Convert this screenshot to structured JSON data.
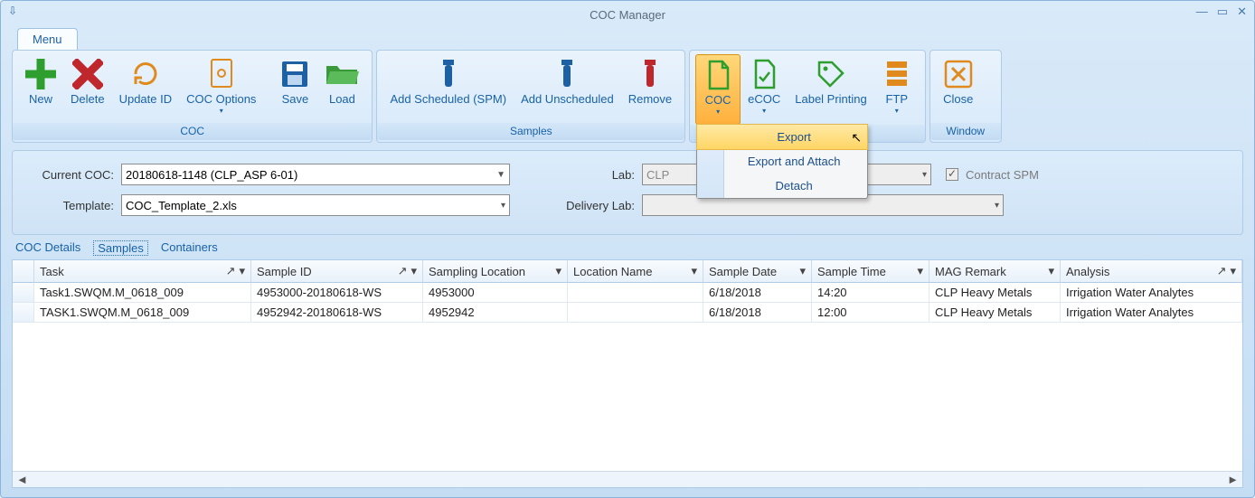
{
  "app": {
    "title": "COC Manager",
    "menu_tab": "Menu"
  },
  "ribbon": {
    "groups": {
      "coc": {
        "label": "COC",
        "new": "New",
        "delete": "Delete",
        "update_id": "Update ID",
        "coc_options": "COC Options",
        "save": "Save",
        "load": "Load"
      },
      "samples": {
        "label": "Samples",
        "add_scheduled": "Add Scheduled (SPM)",
        "add_unscheduled": "Add Unscheduled",
        "remove": "Remove"
      },
      "export": {
        "coc": "COC",
        "ecoc": "eCOC",
        "label_printing": "Label Printing",
        "ftp": "FTP",
        "menu": {
          "export": "Export",
          "export_attach": "Export and Attach",
          "detach": "Detach"
        }
      },
      "window": {
        "label": "Window",
        "close": "Close"
      }
    }
  },
  "form": {
    "current_coc_label": "Current COC:",
    "current_coc_value": "20180618-1148 (CLP_ASP 6-01)",
    "template_label": "Template:",
    "template_value": "COC_Template_2.xls",
    "lab_label": "Lab:",
    "lab_value": "CLP",
    "delivery_lab_label": "Delivery Lab:",
    "delivery_lab_value": "",
    "contract_spm_label": "Contract SPM"
  },
  "subtabs": {
    "coc_details": "COC Details",
    "samples": "Samples",
    "containers": "Containers"
  },
  "grid": {
    "columns": {
      "task": "Task",
      "sample_id": "Sample ID",
      "sampling_location": "Sampling Location",
      "location_name": "Location Name",
      "sample_date": "Sample Date",
      "sample_time": "Sample Time",
      "mag_remark": "MAG Remark",
      "analysis": "Analysis"
    },
    "rows": [
      {
        "task": "Task1.SWQM.M_0618_009",
        "sample_id": "4953000-20180618-WS",
        "sampling_location": "4953000",
        "location_name": "",
        "sample_date": "6/18/2018",
        "sample_time": "14:20",
        "mag_remark": "CLP Heavy Metals",
        "analysis": "Irrigation Water Analytes"
      },
      {
        "task": "TASK1.SWQM.M_0618_009",
        "sample_id": "4952942-20180618-WS",
        "sampling_location": "4952942",
        "location_name": "",
        "sample_date": "6/18/2018",
        "sample_time": "12:00",
        "mag_remark": "CLP Heavy Metals",
        "analysis": "Irrigation Water Analytes"
      }
    ]
  }
}
